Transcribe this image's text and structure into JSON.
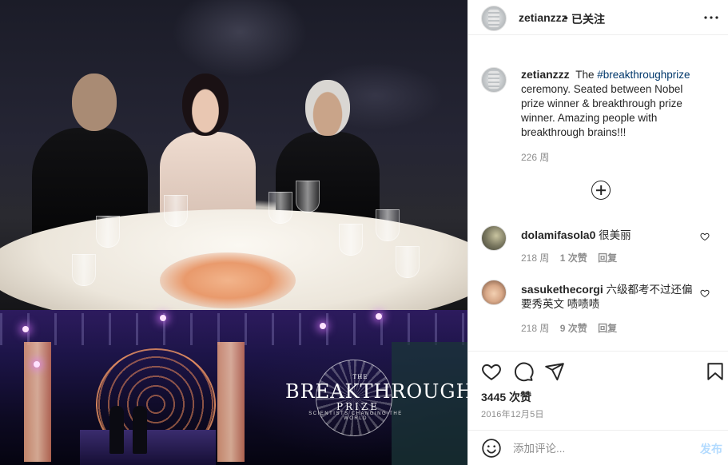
{
  "post": {
    "author": "zetianzzz",
    "separator": "•",
    "follow_state": "已关注",
    "more_icon": "more-horizontal-icon"
  },
  "photo": {
    "brand_the": "THE",
    "brand_main": "BREAKTHROUGH",
    "brand_prize": "PRIZE",
    "brand_sub": "SCIENTISTS CHANGING THE WORLD"
  },
  "caption": {
    "author": "zetianzzz",
    "text_before": "The",
    "hashtag": "#breakthroughprize",
    "text_after": "ceremony. Seated between Nobel prize winner & breakthrough prize winner. Amazing people with breakthrough brains!!!",
    "time": "226 周"
  },
  "comments": [
    {
      "author": "dolamifasola0",
      "text": "很美丽",
      "time": "218 周",
      "likes": "1 次赞",
      "reply": "回复"
    },
    {
      "author": "sasukethecorgi",
      "text": "六级都考不过还偏要秀英文 啧啧啧",
      "time": "218 周",
      "likes": "9 次赞",
      "reply": "回复"
    }
  ],
  "actions": {
    "likes": "3445 次赞",
    "date": "2016年12月5日"
  },
  "add_comment": {
    "placeholder": "添加评论...",
    "post_label": "发布"
  },
  "colors": {
    "text": "#262626",
    "secondary": "#8e8e8e",
    "hashtag": "#00376b",
    "post_disabled": "#b3dbff",
    "border": "#efefef"
  }
}
